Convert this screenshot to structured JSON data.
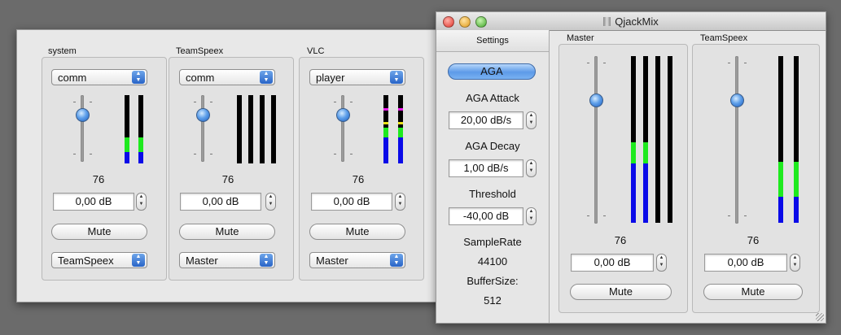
{
  "back_window": {
    "strips": [
      {
        "name": "system",
        "source": "comm",
        "value": "76",
        "gain": "0,00 dB",
        "mute": "Mute",
        "output": "TeamSpeex"
      },
      {
        "name": "TeamSpeex",
        "source": "comm",
        "value": "76",
        "gain": "0,00 dB",
        "mute": "Mute",
        "output": "Master"
      },
      {
        "name": "VLC",
        "source": "player",
        "value": "76",
        "gain": "0,00 dB",
        "mute": "Mute",
        "output": "Master"
      }
    ]
  },
  "front_window": {
    "title": "QjackMix",
    "settings": {
      "header": "Settings",
      "aga_button": "AGA",
      "aga_attack_label": "AGA Attack",
      "aga_attack_value": "20,00 dB/s",
      "aga_decay_label": "AGA Decay",
      "aga_decay_value": "1,00 dB/s",
      "threshold_label": "Threshold",
      "threshold_value": "-40,00 dB",
      "samplerate_label": "SampleRate",
      "samplerate_value": "44100",
      "buffersize_label": "BufferSize:",
      "buffersize_value": "512"
    },
    "strips": [
      {
        "name": "Master",
        "value": "76",
        "gain": "0,00 dB",
        "mute": "Mute"
      },
      {
        "name": "TeamSpeex",
        "value": "76",
        "gain": "0,00 dB",
        "mute": "Mute"
      }
    ]
  },
  "colors": {
    "meter_green": "#1eea1e",
    "meter_blue": "#0a0ae8",
    "accent": "#2864c7"
  },
  "icons": [
    "close-icon",
    "minimize-icon",
    "zoom-icon",
    "app-icon",
    "popup-arrows-icon",
    "stepper-arrows-icon",
    "resize-grip-icon"
  ]
}
